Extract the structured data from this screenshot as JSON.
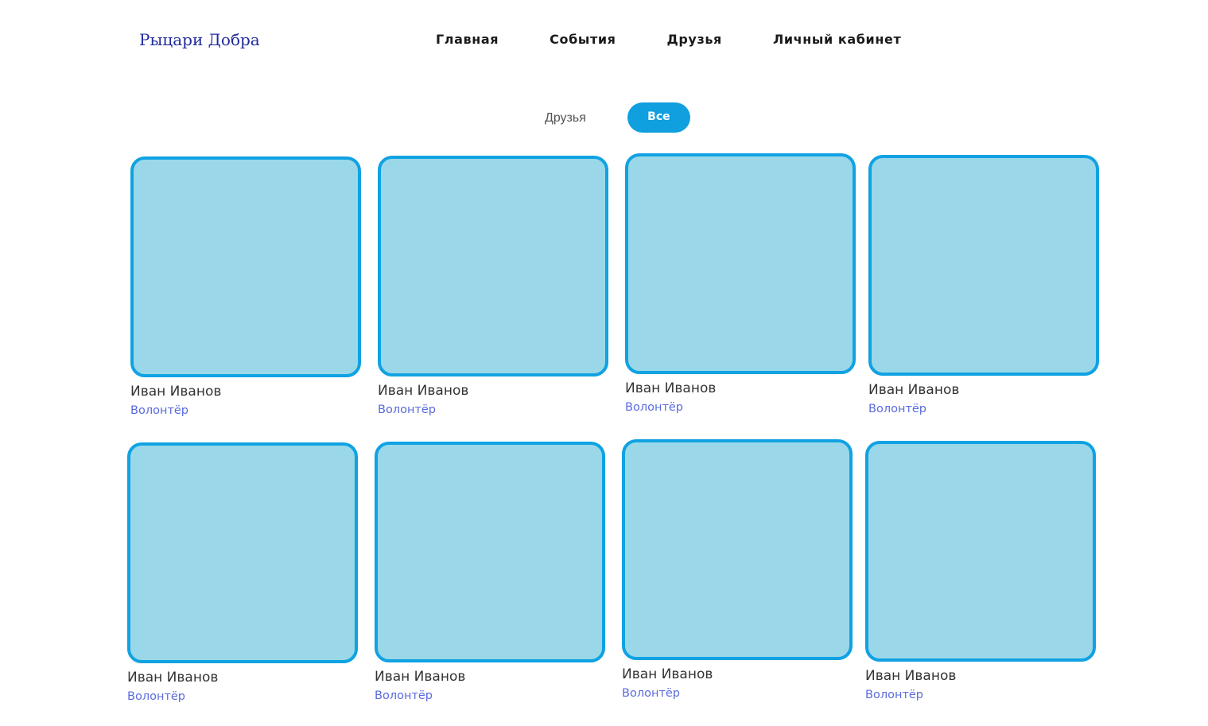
{
  "header": {
    "logo": "Рыцари Добра",
    "nav": [
      {
        "label": "Главная"
      },
      {
        "label": "События"
      },
      {
        "label": "Друзья"
      },
      {
        "label": "Личный кабинет"
      }
    ]
  },
  "filters": {
    "friends_label": "Друзья",
    "all_label": "Все",
    "active": "Все",
    "accent_color": "#109fdf"
  },
  "people": [
    {
      "name": "Иван Иванов",
      "role": "Волонтёр"
    },
    {
      "name": "Иван Иванов",
      "role": "Волонтёр"
    },
    {
      "name": "Иван Иванов",
      "role": "Волонтёр"
    },
    {
      "name": "Иван Иванов",
      "role": "Волонтёр"
    },
    {
      "name": "Иван Иванов",
      "role": "Волонтёр"
    },
    {
      "name": "Иван Иванов",
      "role": "Волонтёр"
    },
    {
      "name": "Иван Иванов",
      "role": "Волонтёр"
    },
    {
      "name": "Иван Иванов",
      "role": "Волонтёр"
    }
  ],
  "colors": {
    "avatar_fill": "#9ad8e9",
    "avatar_border": "#10a2e2",
    "role_text": "#5a6bdc",
    "logo_text": "#1f2a9c"
  }
}
